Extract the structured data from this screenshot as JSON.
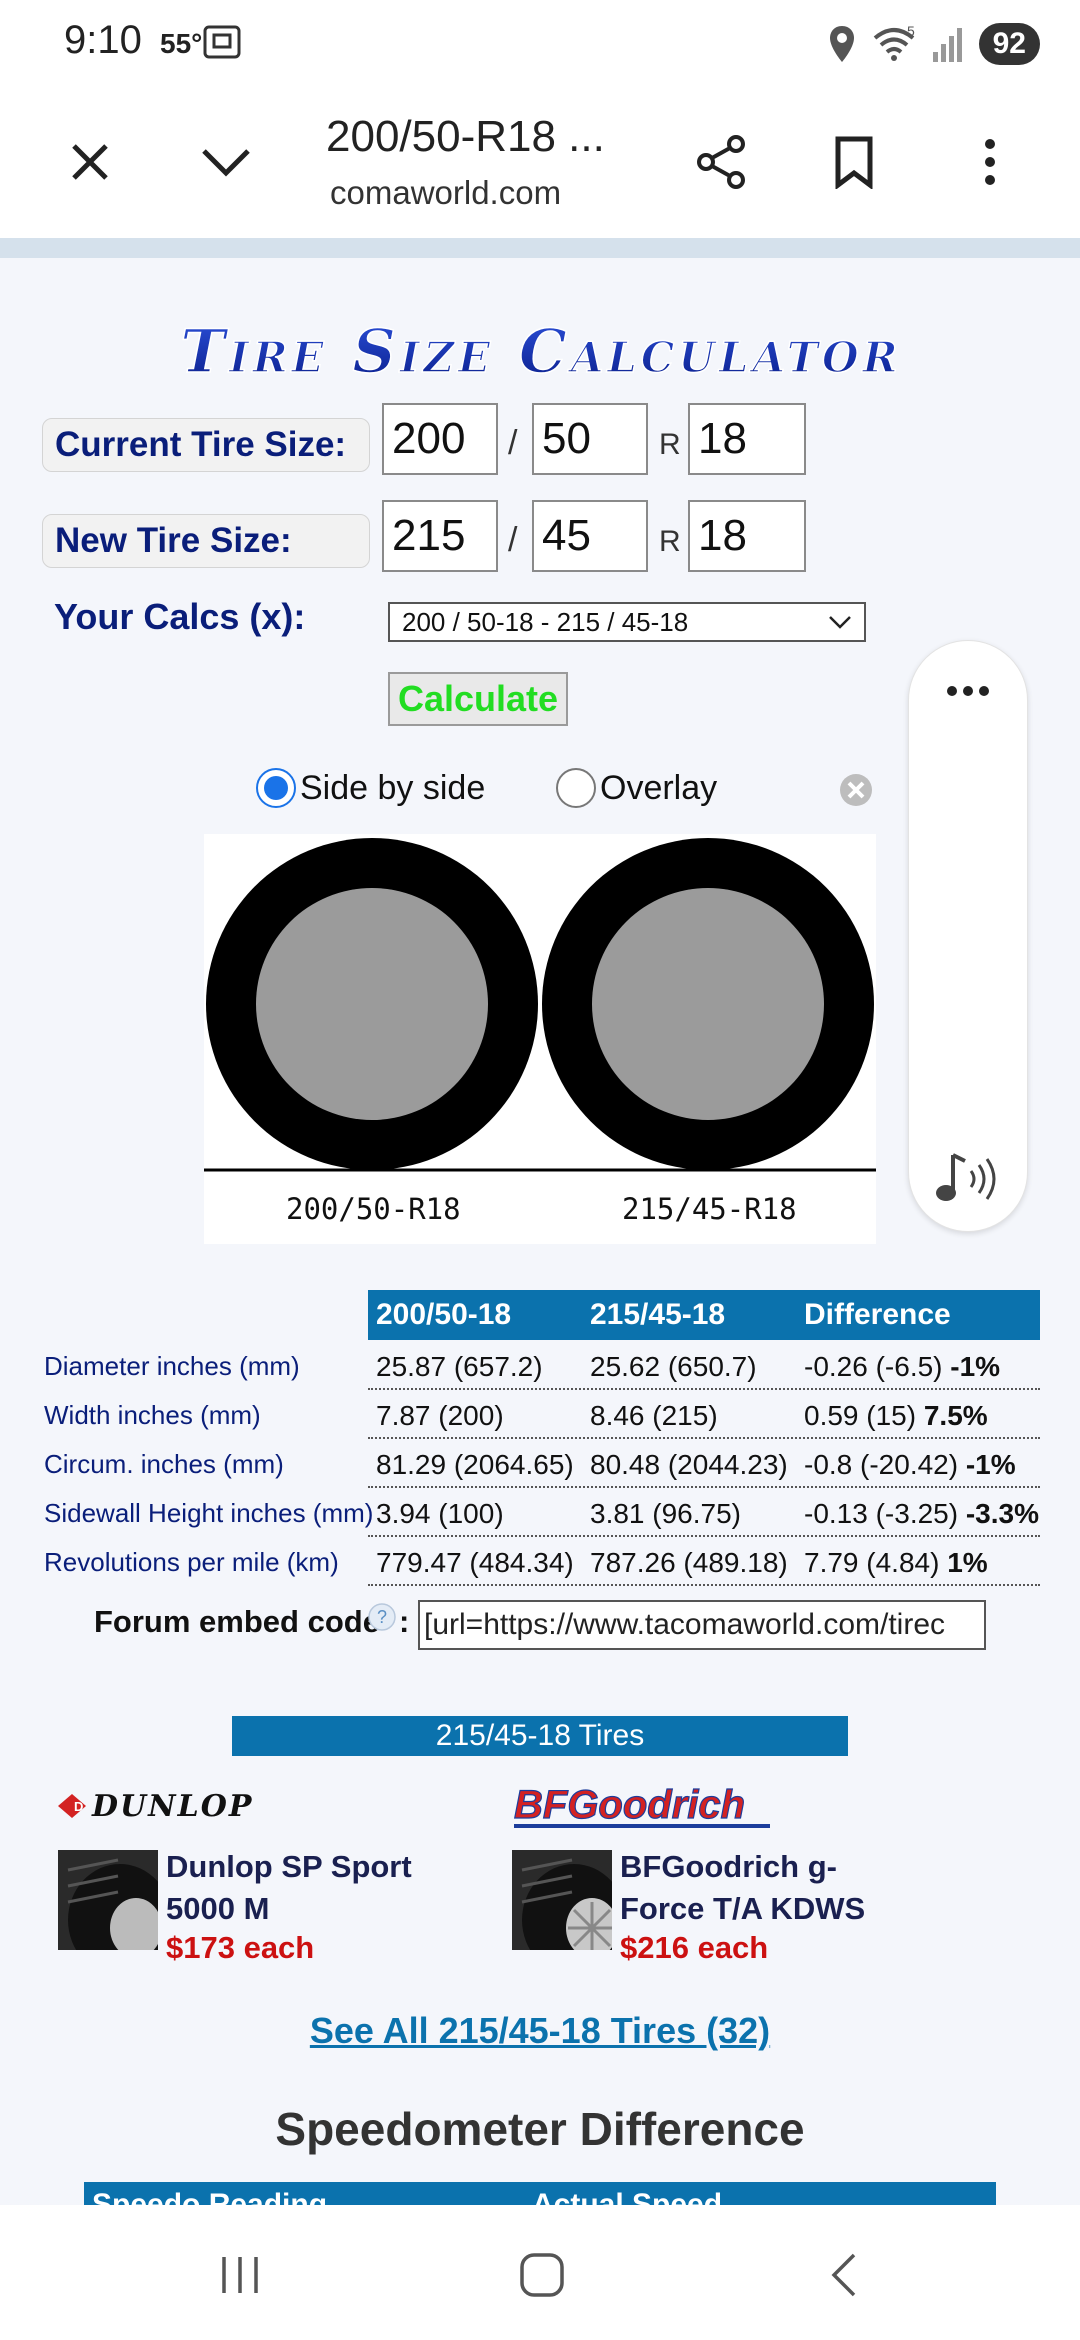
{
  "status": {
    "time": "9:10",
    "temp": "55°",
    "battery": "92",
    "wifi_label": "5"
  },
  "browser": {
    "title": "200/50-R18 ...",
    "domain": "comaworld.com"
  },
  "calculator": {
    "current_label": "Current Tire Size:",
    "current": {
      "width": "200",
      "ratio": "50",
      "rim": "18"
    },
    "new_label": "New Tire Size:",
    "new": {
      "width": "215",
      "ratio": "45",
      "rim": "18"
    },
    "slash": "/",
    "r": "R",
    "calcs_label": "Your Calcs (x):",
    "calcs_selected": "200 / 50-18 - 215 / 45-18",
    "calculate_label": "Calculate",
    "view_side": "Side by side",
    "view_overlay": "Overlay",
    "view_selected": "Side by side",
    "tire1_caption": "200/50-R18",
    "tire2_caption": "215/45-R18"
  },
  "table": {
    "headers": [
      "200/50-18",
      "215/45-18",
      "Difference"
    ],
    "rows": [
      {
        "label": "Diameter inches (mm)",
        "a": "25.87 (657.2)",
        "b": "25.62 (650.7)",
        "diff": "-0.26 (-6.5)",
        "pct": "-1%"
      },
      {
        "label": "Width inches (mm)",
        "a": "7.87 (200)",
        "b": "8.46 (215)",
        "diff": "0.59 (15)",
        "pct": "7.5%"
      },
      {
        "label": "Circum. inches (mm)",
        "a": "81.29 (2064.65)",
        "b": "80.48 (2044.23)",
        "diff": "-0.8 (-20.42)",
        "pct": "-1%"
      },
      {
        "label": "Sidewall Height inches (mm)",
        "a": "3.94 (100)",
        "b": "3.81 (96.75)",
        "diff": "-0.13 (-3.25)",
        "pct": "-3.3%"
      },
      {
        "label": "Revolutions per mile (km)",
        "a": "779.47 (484.34)",
        "b": "787.26 (489.18)",
        "diff": "7.79 (4.84)",
        "pct": "1%"
      }
    ]
  },
  "embed": {
    "label": "Forum embed code",
    "help": "?",
    "colon": ":",
    "value": "[url=https://www.tacomaworld.com/tirec"
  },
  "tires": {
    "bar_title": "215/45-18 Tires",
    "products": [
      {
        "brand": "DUNLOP",
        "name": "Dunlop SP Sport 5000 M",
        "price": "$173 each"
      },
      {
        "brand": "BFGoodrich",
        "name": "BFGoodrich g-Force T/A KDWS",
        "price": "$216 each"
      }
    ],
    "see_all": "See All 215/45-18 Tires (32)"
  },
  "speedo": {
    "heading": "Speedometer Difference",
    "col1": "Speedo Reading",
    "col2": "Actual Speed"
  },
  "logo_text": "Tire Size Calculator",
  "colors": {
    "header_blue": "#0b72ad",
    "label_navy": "#0a1e7a",
    "calc_green": "#22dd22",
    "price_red": "#cc1111"
  }
}
